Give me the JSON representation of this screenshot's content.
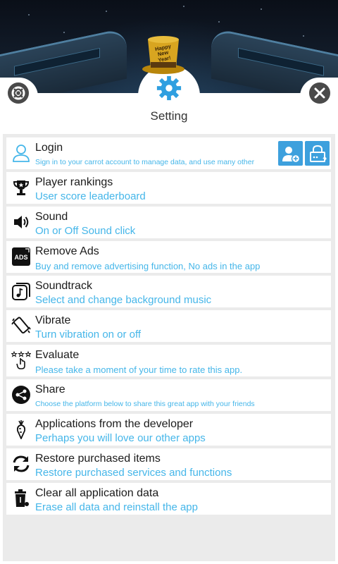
{
  "header": {
    "title": "Setting",
    "hat_text": "Happy New Year!"
  },
  "colors": {
    "accent": "#3da0dd",
    "subtitle": "#45b6e9",
    "panel_bg": "#ebebeb"
  },
  "items": [
    {
      "title": "Login",
      "subtitle": "Sign in to your carrot account to manage data, and use many other",
      "icon": "user-icon"
    },
    {
      "title": "Player rankings",
      "subtitle": "User score leaderboard",
      "icon": "trophy-icon"
    },
    {
      "title": "Sound",
      "subtitle": "On or Off Sound click",
      "icon": "speaker-icon"
    },
    {
      "title": "Remove Ads",
      "subtitle": "Buy and remove advertising function, No ads in the app",
      "icon": "ads-icon",
      "icon_text": "ADS"
    },
    {
      "title": "Soundtrack",
      "subtitle": "Select and change background music",
      "icon": "music-icon"
    },
    {
      "title": "Vibrate",
      "subtitle": "Turn vibration on or off",
      "icon": "vibrate-icon"
    },
    {
      "title": "Evaluate",
      "subtitle": "Please take a moment of your time to rate this app.",
      "icon": "rate-icon"
    },
    {
      "title": "Share",
      "subtitle": "Choose the platform below to share this great app with your friends",
      "icon": "share-icon"
    },
    {
      "title": "Applications from the developer",
      "subtitle": "Perhaps you will love our other apps",
      "icon": "carrot-icon"
    },
    {
      "title": "Restore purchased items",
      "subtitle": "Restore purchased services and functions",
      "icon": "restore-icon"
    },
    {
      "title": "Clear all application data",
      "subtitle": "Erase all data and reinstall the app",
      "icon": "trash-icon"
    }
  ]
}
